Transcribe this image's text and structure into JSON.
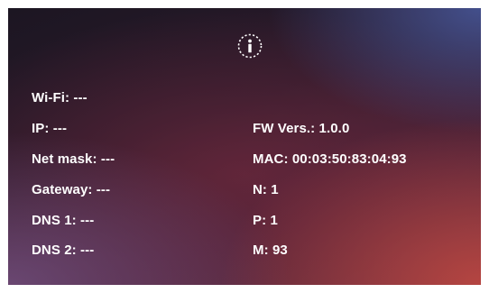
{
  "info_icon": "info-icon",
  "left_fields": [
    {
      "label": "Wi-Fi:",
      "value": "---"
    },
    {
      "label": "IP:",
      "value": "---"
    },
    {
      "label": "Net mask:",
      "value": "---"
    },
    {
      "label": "Gateway:",
      "value": "---"
    },
    {
      "label": "DNS 1:",
      "value": "---"
    },
    {
      "label": "DNS 2:",
      "value": "---"
    }
  ],
  "right_fields": [
    {
      "label": "FW Vers.:",
      "value": "1.0.0"
    },
    {
      "label": "MAC:",
      "value": "00:03:50:83:04:93"
    },
    {
      "label": "N:",
      "value": "1"
    },
    {
      "label": "P:",
      "value": "1"
    },
    {
      "label": "M:",
      "value": "93"
    }
  ],
  "colors": {
    "text": "#ffffff"
  }
}
